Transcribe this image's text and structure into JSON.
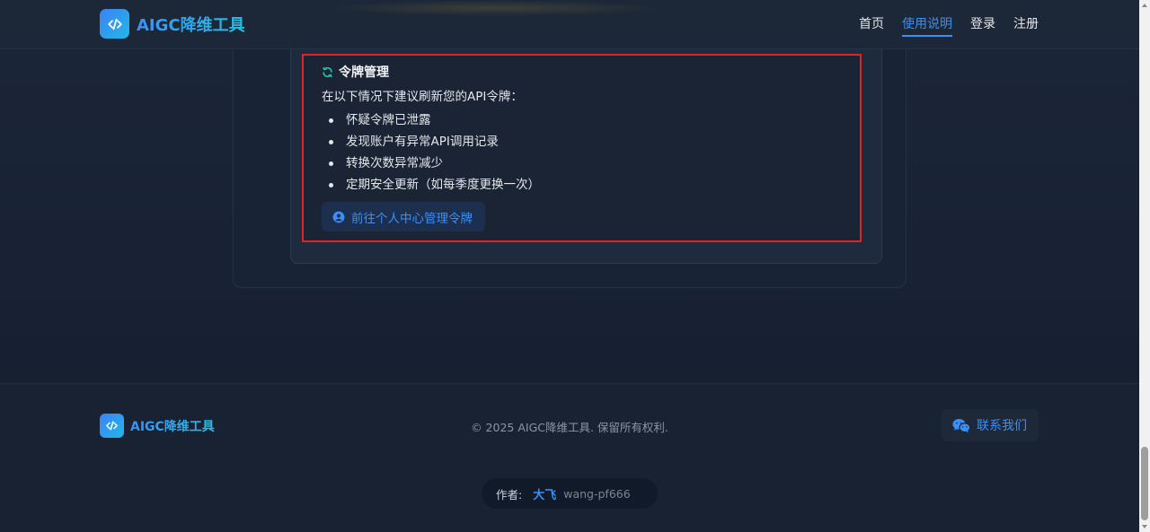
{
  "header": {
    "brand": "AIGC降维工具",
    "nav": [
      {
        "label": "首页",
        "active": false
      },
      {
        "label": "使用说明",
        "active": true
      },
      {
        "label": "登录",
        "active": false
      },
      {
        "label": "注册",
        "active": false
      }
    ]
  },
  "token_section": {
    "title": "令牌管理",
    "description": "在以下情况下建议刷新您的API令牌：",
    "items": [
      "怀疑令牌已泄露",
      "发现账户有异常API调用记录",
      "转换次数异常减少",
      "定期安全更新（如每季度更换一次）"
    ],
    "button_label": "前往个人中心管理令牌"
  },
  "footer": {
    "brand": "AIGC降维工具",
    "copyright": "© 2025 AIGC降维工具. 保留所有权利.",
    "contact_label": "联系我们",
    "author_label": "作者:",
    "author_name": "大飞",
    "author_id": "wang-pf666"
  },
  "colors": {
    "accent": "#3b8ff6",
    "highlight_border": "#dc2626",
    "background": "#151e2e"
  },
  "icons": {
    "brand": "code-icon",
    "token_title": "sync-icon",
    "button": "user-circle-icon",
    "contact": "wechat-icon"
  }
}
